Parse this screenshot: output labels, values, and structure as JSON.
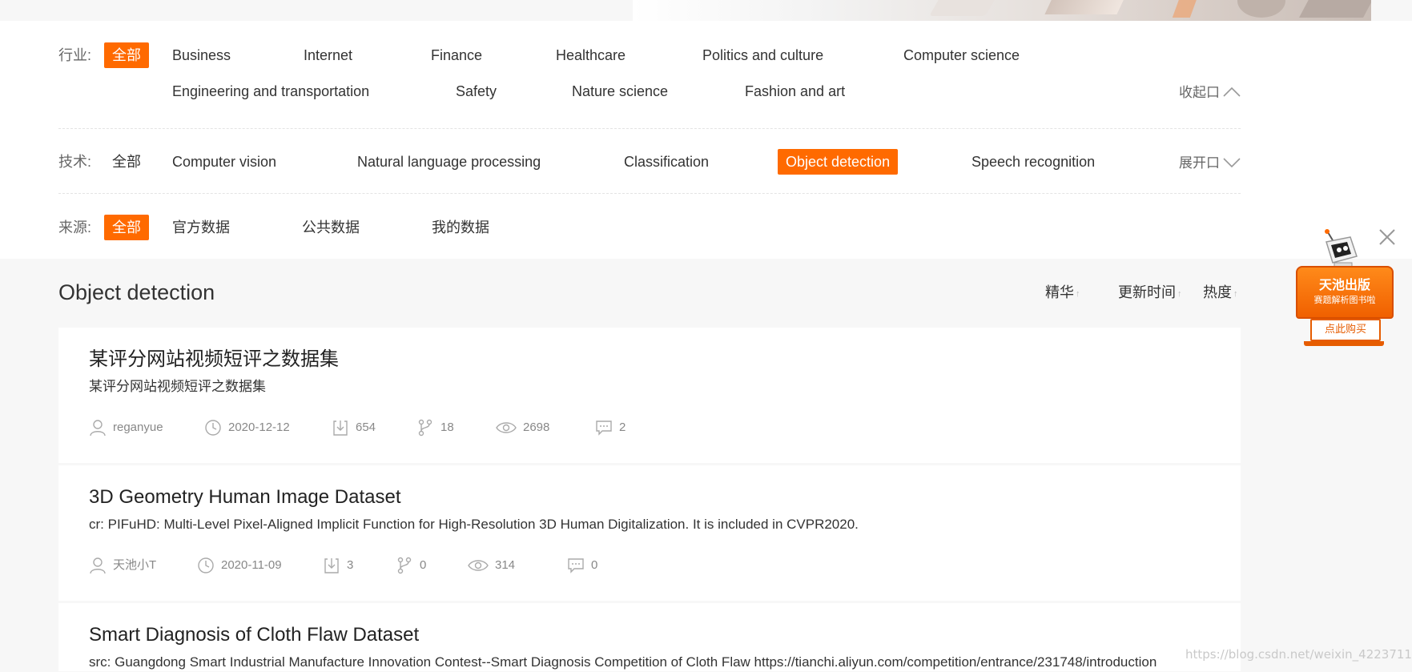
{
  "filters": {
    "industry": {
      "label": "行业:",
      "all": "全部",
      "items": [
        "Business",
        "Internet",
        "Finance",
        "Healthcare",
        "Politics and culture",
        "Computer science",
        "Engineering and transportation",
        "Safety",
        "Nature science",
        "Fashion and art"
      ],
      "toggle": "收起口"
    },
    "tech": {
      "label": "技术:",
      "all": "全部",
      "items": [
        "Computer vision",
        "Natural language processing",
        "Classification",
        "Object detection",
        "Speech recognition"
      ],
      "selected": "Object detection",
      "toggle": "展开口"
    },
    "source": {
      "label": "来源:",
      "all": "全部",
      "items": [
        "官方数据",
        "公共数据",
        "我的数据"
      ]
    }
  },
  "results": {
    "title": "Object detection",
    "sort": [
      "精华",
      "更新时间",
      "热度"
    ],
    "datasets": [
      {
        "title": "某评分网站视频短评之数据集",
        "description": "某评分网站视频短评之数据集",
        "author": "reganyue",
        "date": "2020-12-12",
        "downloads": "654",
        "forks": "18",
        "views": "2698",
        "comments": "2"
      },
      {
        "title": "3D Geometry Human Image Dataset",
        "description": "cr: PIFuHD: Multi-Level Pixel-Aligned Implicit Function for High-Resolution 3D Human Digitalization. It is included in CVPR2020.",
        "author": "天池小T",
        "date": "2020-11-09",
        "downloads": "3",
        "forks": "0",
        "views": "314",
        "comments": "0"
      },
      {
        "title": "Smart Diagnosis of Cloth Flaw Dataset",
        "description": "src: Guangdong Smart Industrial Manufacture Innovation Contest--Smart Diagnosis Competition of Cloth Flaw https://tianchi.aliyun.com/competition/entrance/231748/introduction"
      }
    ]
  },
  "promo": {
    "line1": "天池出版",
    "line2": "赛题解析图书啦",
    "button": "点此购买"
  },
  "watermark": "https://blog.csdn.net/weixin_42237113",
  "colors": {
    "accent": "#ff6a00",
    "page_bg": "#f7f7f7"
  }
}
